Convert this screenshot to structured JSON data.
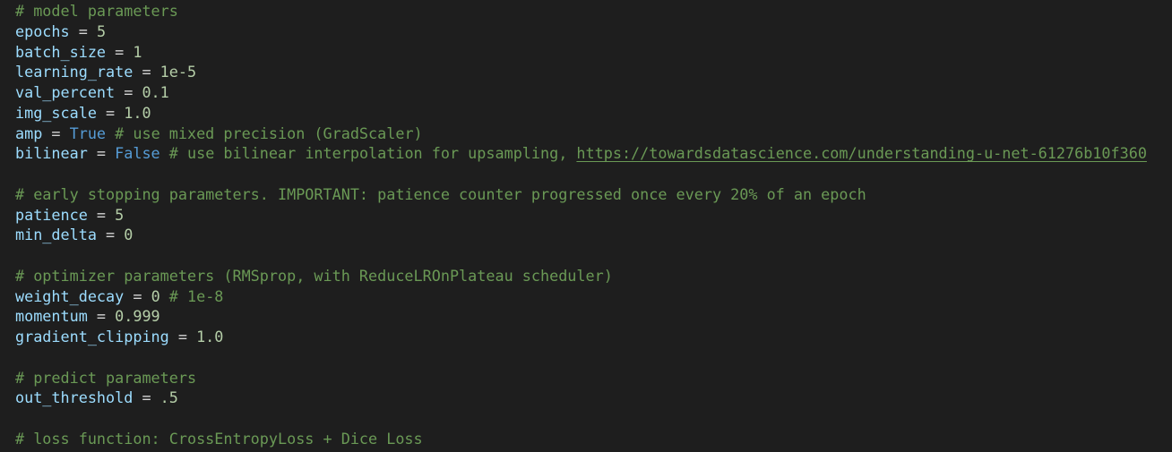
{
  "colors": {
    "background": "#1e1e1e",
    "comment": "#6a9955",
    "variable": "#9cdcfe",
    "operator": "#d4d4d4",
    "number": "#b5cea8",
    "keyword": "#569cd6"
  },
  "lines": [
    {
      "tokens": [
        {
          "t": "comment",
          "v": "# model parameters"
        }
      ]
    },
    {
      "tokens": [
        {
          "t": "var",
          "v": "epochs"
        },
        {
          "t": "op",
          "v": " = "
        },
        {
          "t": "num",
          "v": "5"
        }
      ]
    },
    {
      "tokens": [
        {
          "t": "var",
          "v": "batch_size"
        },
        {
          "t": "op",
          "v": " = "
        },
        {
          "t": "num",
          "v": "1"
        }
      ]
    },
    {
      "tokens": [
        {
          "t": "var",
          "v": "learning_rate"
        },
        {
          "t": "op",
          "v": " = "
        },
        {
          "t": "num",
          "v": "1e-5"
        }
      ]
    },
    {
      "tokens": [
        {
          "t": "var",
          "v": "val_percent"
        },
        {
          "t": "op",
          "v": " = "
        },
        {
          "t": "num",
          "v": "0.1"
        }
      ]
    },
    {
      "tokens": [
        {
          "t": "var",
          "v": "img_scale"
        },
        {
          "t": "op",
          "v": " = "
        },
        {
          "t": "num",
          "v": "1.0"
        }
      ]
    },
    {
      "tokens": [
        {
          "t": "var",
          "v": "amp"
        },
        {
          "t": "op",
          "v": " = "
        },
        {
          "t": "kw",
          "v": "True"
        },
        {
          "t": "comment",
          "v": " # use mixed precision (GradScaler)"
        }
      ]
    },
    {
      "tokens": [
        {
          "t": "var",
          "v": "bilinear"
        },
        {
          "t": "op",
          "v": " = "
        },
        {
          "t": "kw",
          "v": "False"
        },
        {
          "t": "comment",
          "v": " # use bilinear interpolation for upsampling, "
        },
        {
          "t": "link",
          "v": "https://towardsdatascience.com/understanding-u-net-61276b10f360"
        }
      ]
    },
    {
      "tokens": []
    },
    {
      "tokens": [
        {
          "t": "comment",
          "v": "# early stopping parameters. IMPORTANT: patience counter progressed once every 20% of an epoch"
        }
      ]
    },
    {
      "tokens": [
        {
          "t": "var",
          "v": "patience"
        },
        {
          "t": "op",
          "v": " = "
        },
        {
          "t": "num",
          "v": "5"
        }
      ]
    },
    {
      "tokens": [
        {
          "t": "var",
          "v": "min_delta"
        },
        {
          "t": "op",
          "v": " = "
        },
        {
          "t": "num",
          "v": "0"
        }
      ]
    },
    {
      "tokens": []
    },
    {
      "tokens": [
        {
          "t": "comment",
          "v": "# optimizer parameters (RMSprop, with ReduceLROnPlateau scheduler)"
        }
      ]
    },
    {
      "tokens": [
        {
          "t": "var",
          "v": "weight_decay"
        },
        {
          "t": "op",
          "v": " = "
        },
        {
          "t": "num",
          "v": "0"
        },
        {
          "t": "comment",
          "v": " # 1e-8"
        }
      ]
    },
    {
      "tokens": [
        {
          "t": "var",
          "v": "momentum"
        },
        {
          "t": "op",
          "v": " = "
        },
        {
          "t": "num",
          "v": "0.999"
        }
      ]
    },
    {
      "tokens": [
        {
          "t": "var",
          "v": "gradient_clipping"
        },
        {
          "t": "op",
          "v": " = "
        },
        {
          "t": "num",
          "v": "1.0"
        }
      ]
    },
    {
      "tokens": []
    },
    {
      "tokens": [
        {
          "t": "comment",
          "v": "# predict parameters"
        }
      ]
    },
    {
      "tokens": [
        {
          "t": "var",
          "v": "out_threshold"
        },
        {
          "t": "op",
          "v": " = "
        },
        {
          "t": "num",
          "v": ".5"
        }
      ]
    },
    {
      "tokens": []
    },
    {
      "tokens": [
        {
          "t": "comment",
          "v": "# loss function: CrossEntropyLoss + Dice Loss"
        }
      ]
    }
  ]
}
